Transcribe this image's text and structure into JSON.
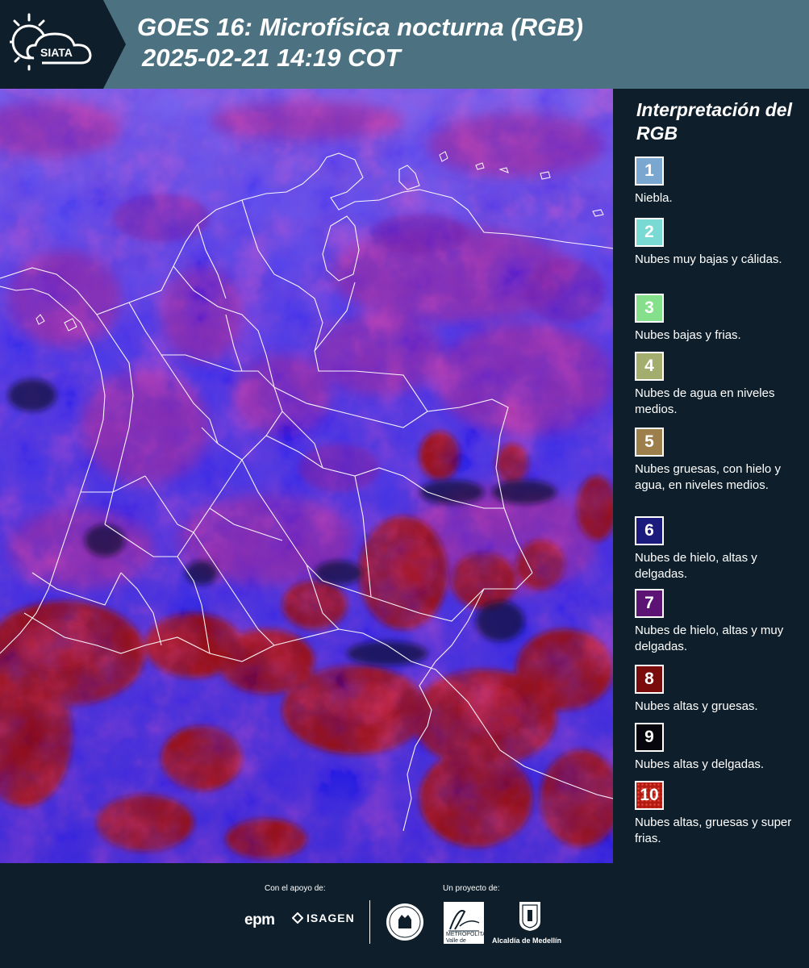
{
  "header": {
    "logo_text": "SIATA",
    "title": "GOES 16: Microfísica nocturna (RGB)",
    "timestamp": "2025-02-21 14:19 COT"
  },
  "legend": {
    "title": "Interpretación del RGB",
    "items": [
      {
        "number": "1",
        "label": "Niebla.",
        "color": "#7aa7cf"
      },
      {
        "number": "2",
        "label": "Nubes muy bajas y cálidas.",
        "color": "#78dad2"
      },
      {
        "number": "3",
        "label": "Nubes bajas y frias.",
        "color": "#84e08a"
      },
      {
        "number": "4",
        "label": "Nubes de agua en niveles medios.",
        "color": "#a3ad6e"
      },
      {
        "number": "5",
        "label": "Nubes gruesas, con hielo y agua, en niveles medios.",
        "color": "#9c7f4b"
      },
      {
        "number": "6",
        "label": "Nubes de hielo, altas y delgadas.",
        "color": "#1a1b7d"
      },
      {
        "number": "7",
        "label": "Nubes de hielo, altas y muy delgadas.",
        "color": "#5d1374"
      },
      {
        "number": "8",
        "label": "Nubes altas y gruesas.",
        "color": "#7a0c0c"
      },
      {
        "number": "9",
        "label": "Nubes altas y delgadas.",
        "color": "#07060c"
      },
      {
        "number": "10",
        "label": "Nubes altas, gruesas y super frias.",
        "color": "#b21a12"
      }
    ]
  },
  "footer": {
    "support_label": "Con el apoyo de:",
    "project_label": "Un proyecto de:",
    "sponsors": [
      "epm",
      "ISAGEN"
    ],
    "area_logo_text": "METROPOLITANA Valle de Aburrá",
    "medellin_text": "Alcaldía de Medellín"
  },
  "colors": {
    "header_bg": "#4c7282",
    "dark_bg": "#0e1f2b",
    "map_blue": "#3a2ad8",
    "map_magenta": "#9a2a9a",
    "map_red": "#9a0f10"
  }
}
